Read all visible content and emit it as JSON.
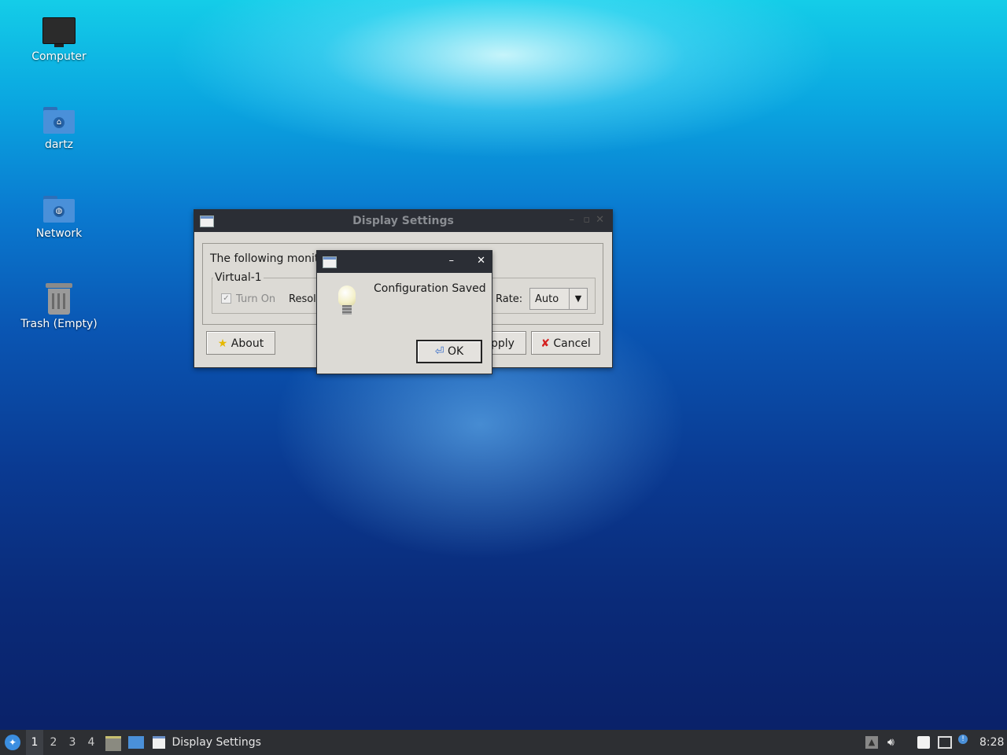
{
  "desktop": {
    "icons": [
      {
        "label": "Computer",
        "icon": "computer-icon"
      },
      {
        "label": "dartz",
        "icon": "home-folder-icon"
      },
      {
        "label": "Network",
        "icon": "network-folder-icon"
      },
      {
        "label": "Trash (Empty)",
        "icon": "trash-icon"
      }
    ]
  },
  "display_settings": {
    "title": "Display Settings",
    "intro_text": "The following monit",
    "monitor_group": "Virtual-1",
    "turn_on_label": "Turn On",
    "turn_on_checked": true,
    "resolution_label": "Resol",
    "rate_label": "Rate:",
    "rate_value": "Auto",
    "about_label": "About",
    "apply_label": "pply",
    "cancel_label": "Cancel"
  },
  "dialog": {
    "message": "Configuration Saved",
    "ok_label": "OK",
    "minimize": "–",
    "close": "✕",
    "icon": "lightbulb-icon"
  },
  "taskbar": {
    "workspaces": [
      "1",
      "2",
      "3",
      "4"
    ],
    "active_workspace": "1",
    "task_label": "Display Settings",
    "clock": "8:28"
  },
  "colors": {
    "titlebar": "#2b2e35",
    "window_bg": "#dcdad5",
    "taskbar": "#2d2f33"
  }
}
